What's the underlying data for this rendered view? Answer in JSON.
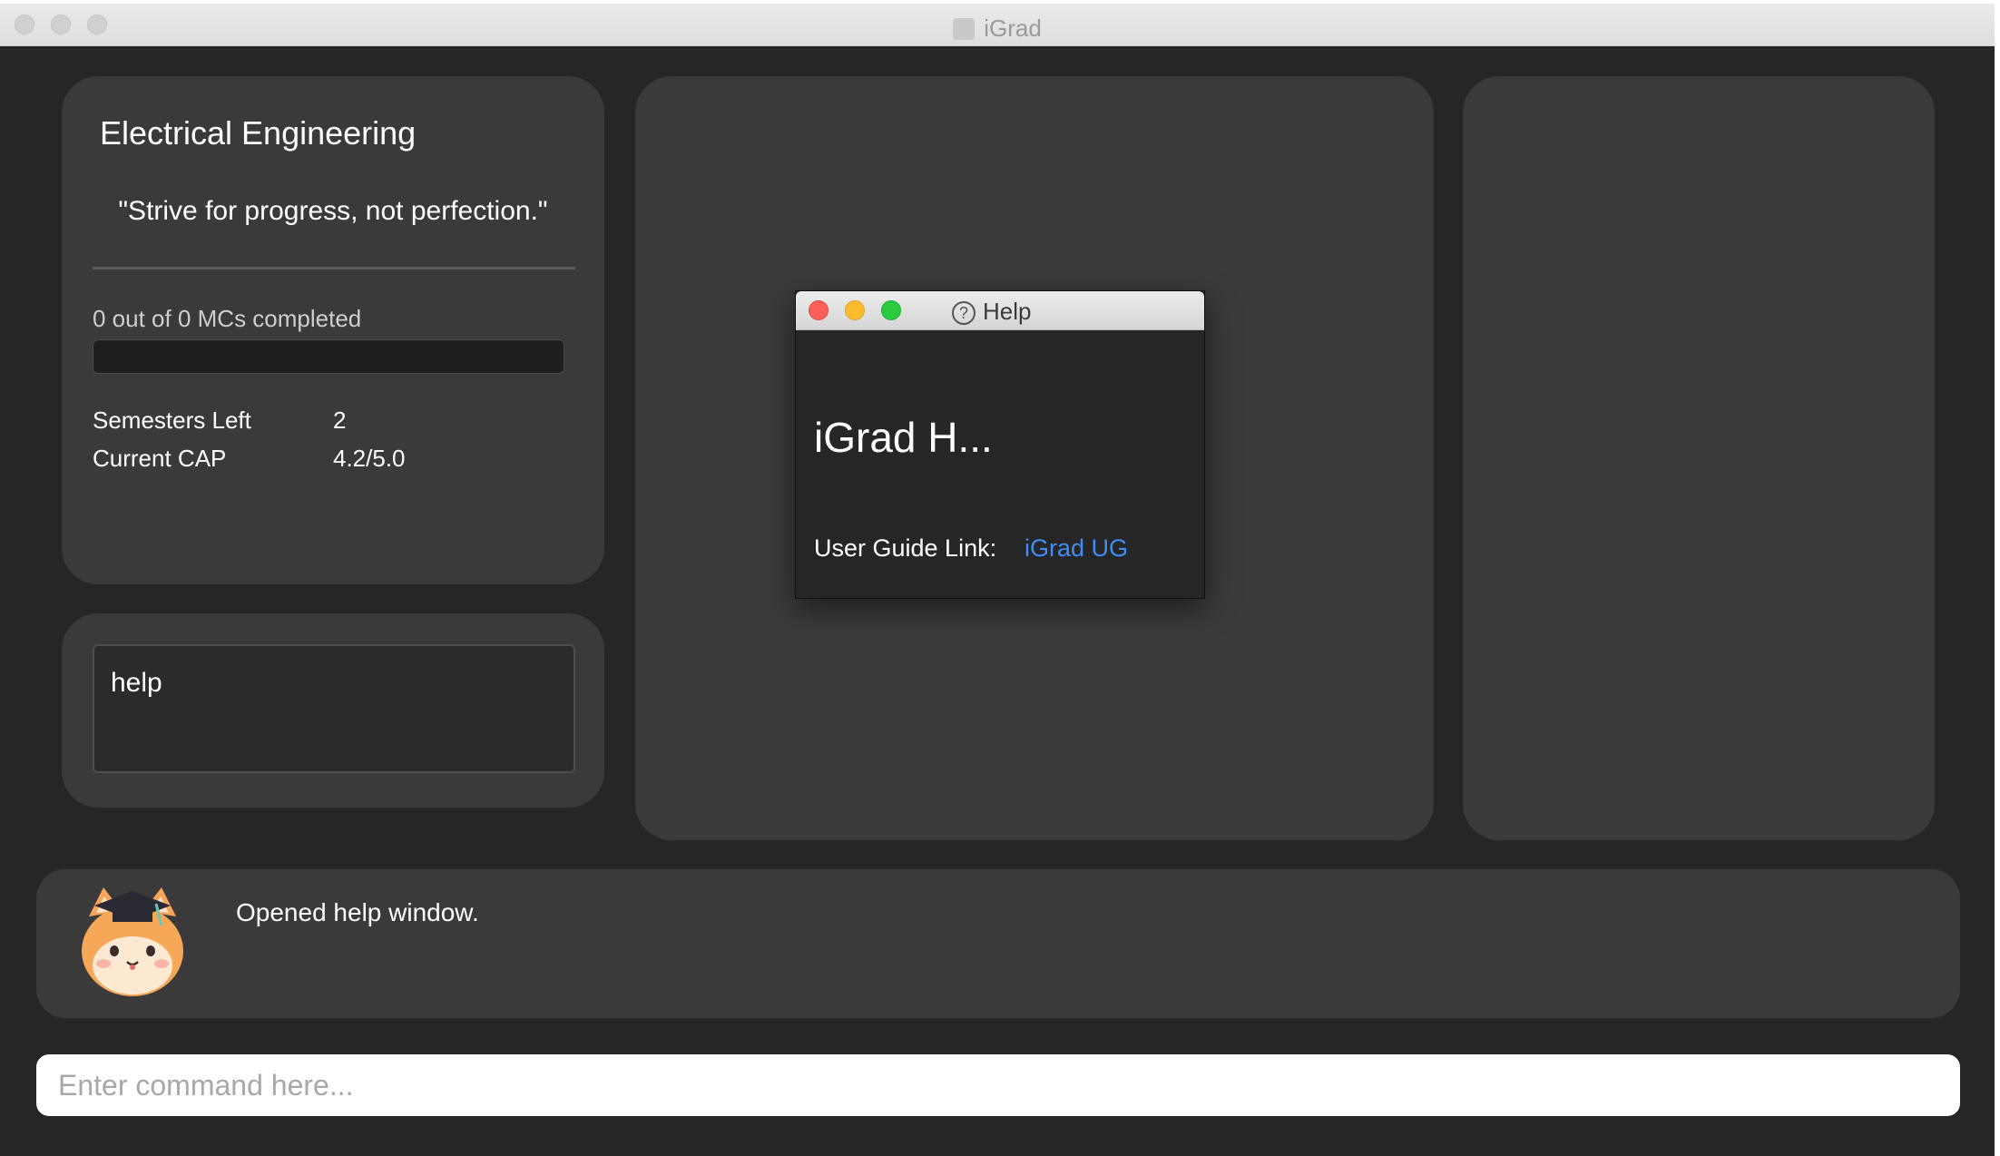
{
  "window": {
    "title": "iGrad"
  },
  "profile": {
    "program": "Electrical Engineering",
    "quote": "\"Strive for progress, not perfection.\"",
    "mc_text": "0 out of 0 MCs completed",
    "mc_progress_fraction": 0,
    "stats": [
      {
        "label": "Semesters Left",
        "value": "2"
      },
      {
        "label": "Current CAP",
        "value": "4.2/5.0"
      }
    ]
  },
  "history": {
    "text": "help"
  },
  "result": {
    "text": "Opened help window.",
    "mascot": "graduate-cat-icon"
  },
  "command": {
    "placeholder": "Enter command here..."
  },
  "help_dialog": {
    "title": "Help",
    "heading": "iGrad H...",
    "link_label": "User Guide Link:",
    "link_text": "iGrad UG",
    "colors": {
      "close": "#fc5f57",
      "minimize": "#fdbc2e",
      "maximize": "#29c940",
      "link": "#3d8ff5"
    }
  },
  "colors": {
    "window_bg": "#262626",
    "panel_bg": "#3a3a3a"
  }
}
